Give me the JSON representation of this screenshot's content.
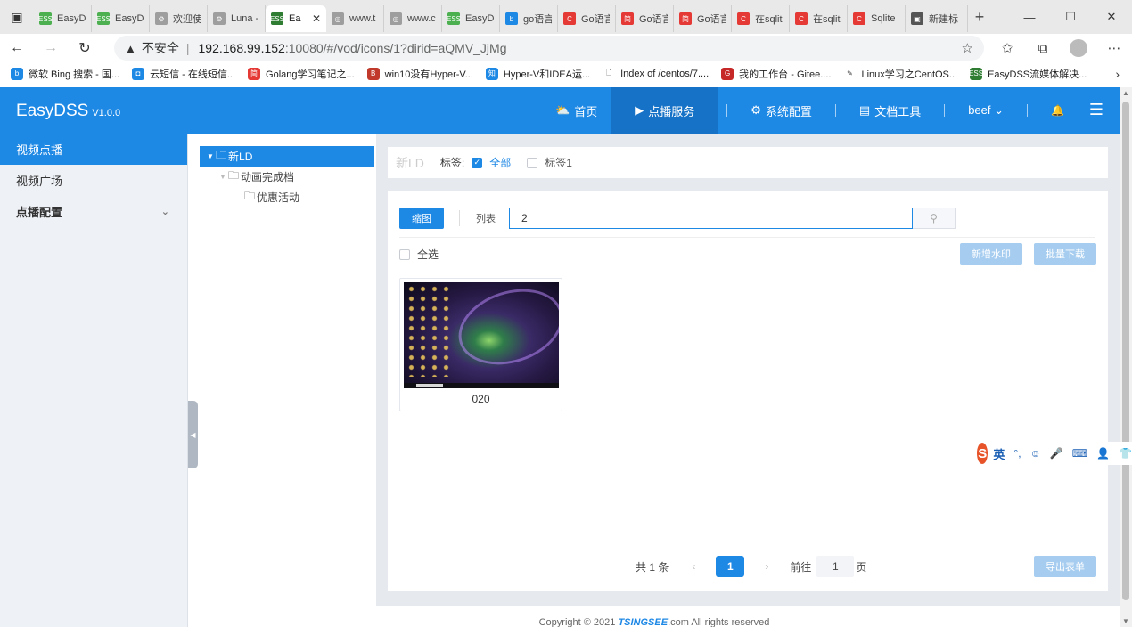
{
  "browser": {
    "tabs": [
      {
        "title": "EasyDS",
        "fav_color": "#4caf50",
        "fav_text": "ESS"
      },
      {
        "title": "EasyDS",
        "fav_color": "#4caf50",
        "fav_text": "ESS"
      },
      {
        "title": "欢迎使",
        "fav_color": "#9e9e9e",
        "fav_text": "⚙"
      },
      {
        "title": "Luna -",
        "fav_color": "#9e9e9e",
        "fav_text": "⚙"
      },
      {
        "title": "Ea",
        "fav_color": "#2e7d32",
        "fav_text": "ESS",
        "active": true
      },
      {
        "title": "www.t",
        "fav_color": "#9e9e9e",
        "fav_text": "◎"
      },
      {
        "title": "www.c",
        "fav_color": "#9e9e9e",
        "fav_text": "◎"
      },
      {
        "title": "EasyD",
        "fav_color": "#4caf50",
        "fav_text": "ESS"
      },
      {
        "title": "go语言",
        "fav_color": "#1e88e5",
        "fav_text": "b"
      },
      {
        "title": "Go语言",
        "fav_color": "#e53935",
        "fav_text": "C"
      },
      {
        "title": "Go语言",
        "fav_color": "#e53935",
        "fav_text": "简"
      },
      {
        "title": "Go语言",
        "fav_color": "#e53935",
        "fav_text": "简"
      },
      {
        "title": "在sqlit",
        "fav_color": "#e53935",
        "fav_text": "C"
      },
      {
        "title": "在sqlit",
        "fav_color": "#e53935",
        "fav_text": "C"
      },
      {
        "title": "Sqlite",
        "fav_color": "#e53935",
        "fav_text": "C"
      },
      {
        "title": "新建标",
        "fav_color": "#555555",
        "fav_text": "▣"
      }
    ],
    "active_close": "✕",
    "newtab": "+",
    "window_controls": {
      "minimize": "—",
      "maximize": "☐",
      "close": "✕"
    },
    "address": {
      "warning_icon": "▲",
      "insecure_label": "不安全",
      "separator": "|",
      "host": "192.168.99.152",
      "rest": ":10080/#/vod/icons/1?dirid=aQMV_JjMg"
    },
    "bookmarks": [
      {
        "label": "微软 Bing 搜索 - 国...",
        "fav_color": "#1e88e5",
        "fav_text": "b"
      },
      {
        "label": "云短信 - 在线短信...",
        "fav_color": "#1e88e5",
        "fav_text": "◘"
      },
      {
        "label": "Golang学习笔记之...",
        "fav_color": "#e53935",
        "fav_text": "简"
      },
      {
        "label": "win10没有Hyper-V...",
        "fav_color": "#c0392b",
        "fav_text": "B"
      },
      {
        "label": "Hyper-V和IDEA运...",
        "fav_color": "#1e88e5",
        "fav_text": "知"
      },
      {
        "label": "Index of /centos/7....",
        "fav_color": "#ffffff",
        "fav_text": "🗋"
      },
      {
        "label": "我的工作台 - Gitee....",
        "fav_color": "#c62828",
        "fav_text": "G"
      },
      {
        "label": "Linux学习之CentOS...",
        "fav_color": "#ffffff",
        "fav_text": "✎"
      },
      {
        "label": "EasyDSS流媒体解决...",
        "fav_color": "#2e7d32",
        "fav_text": "ESS"
      }
    ]
  },
  "app": {
    "logo": "EasyDSS",
    "version": "V1.0.0",
    "nav": [
      {
        "label": "首页",
        "icon": "⛅"
      },
      {
        "label": "点播服务",
        "icon": "▶",
        "active": true
      },
      {
        "label": "系统配置",
        "icon": "⚙"
      },
      {
        "label": "文档工具",
        "icon": "▤"
      },
      {
        "label": "beef ⌄",
        "icon": ""
      }
    ],
    "bell_icon": "🔔",
    "menu_icon": "☰"
  },
  "sidebar": {
    "items": [
      {
        "label": "视频点播",
        "active": true
      },
      {
        "label": "视频广场"
      },
      {
        "label": "点播配置",
        "chevron": "⌄"
      }
    ]
  },
  "tree": {
    "nodes": [
      {
        "label": "新LD",
        "level": 0,
        "selected": true,
        "arrow": "▼"
      },
      {
        "label": "动画完成档",
        "level": 1,
        "arrow": "▼"
      },
      {
        "label": "优惠活动",
        "level": 2,
        "arrow": ""
      }
    ]
  },
  "content": {
    "dir_name": "新LD",
    "tag_label": "标签:",
    "tags": [
      "全部",
      "标签1"
    ],
    "view_thumb": "缩图",
    "view_list": "列表",
    "search_value": "2",
    "select_all": "全选",
    "add_watermark": "新增水印",
    "batch_download": "批量下载",
    "items": [
      {
        "name": "020"
      }
    ],
    "pager": {
      "total": "共 1 条",
      "prev": "‹",
      "current": "1",
      "next": "›",
      "goto_label": "前往",
      "goto_value": "1",
      "unit": "页"
    },
    "export": "导出表单"
  },
  "footer": {
    "prefix": "Copyright © 2021",
    "brand": "TSINGSEE",
    "suffix": ".com All rights reserved"
  },
  "ime": {
    "logo": "S",
    "lang": "英",
    "icons": [
      "°,",
      "☺",
      "🎤",
      "⌨",
      "👤",
      "👕"
    ]
  }
}
